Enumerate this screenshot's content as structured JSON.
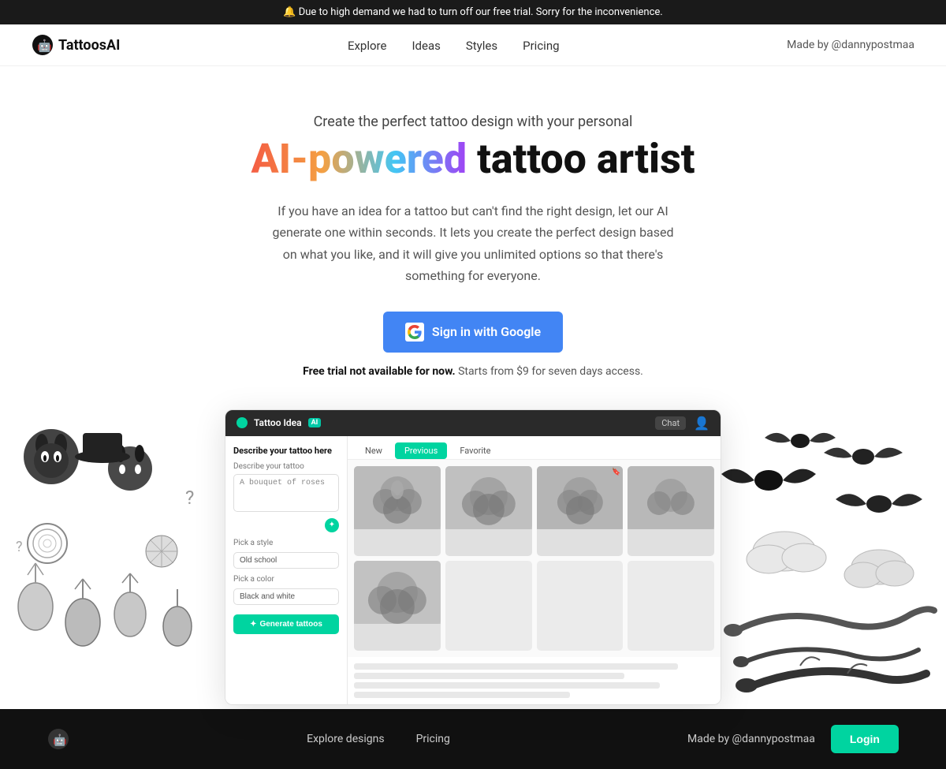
{
  "announcement": {
    "icon": "🔔",
    "text": "Due to high demand we had to turn off our free trial. Sorry for the inconvenience."
  },
  "header": {
    "logo_text": "TattoosAI",
    "nav": [
      {
        "label": "Explore",
        "href": "#"
      },
      {
        "label": "Ideas",
        "href": "#"
      },
      {
        "label": "Styles",
        "href": "#"
      },
      {
        "label": "Pricing",
        "href": "#"
      }
    ],
    "made_by": "Made by @dannypostmaa"
  },
  "hero": {
    "subtitle": "Create the perfect tattoo design with your personal",
    "title_ai": "AI-powered",
    "title_rest": " tattoo artist",
    "description": "If you have an idea for a tattoo but can't find the right design, let our AI generate one within seconds. It lets you create the perfect design based on what you like, and it will give you unlimited options so that there's something for everyone.",
    "signin_btn": "Sign in with Google",
    "trial_note_bold": "Free trial not available for now.",
    "trial_note_rest": " Starts from $9 for seven days access."
  },
  "app_window": {
    "title": "Tattoo Idea",
    "ai_badge": "AI",
    "chat_label": "Chat",
    "tabs": [
      "New",
      "Previous",
      "Favorite"
    ],
    "active_tab": "Previous",
    "sidebar": {
      "describe_label": "Describe your tattoo here",
      "describe_sublabel": "Describe your tattoo",
      "describe_value": "A bouquet of roses",
      "style_label": "Pick a style",
      "style_value": "Old school",
      "color_label": "Pick a color",
      "color_value": "Black and white",
      "generate_btn": "Generate tattoos"
    }
  },
  "footer": {
    "explore": "Explore designs",
    "pricing": "Pricing",
    "made_by": "Made by @dannypostmaa",
    "login_btn": "Login"
  }
}
